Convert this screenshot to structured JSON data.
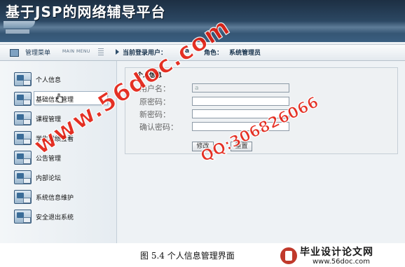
{
  "app": {
    "title": "基于JSP的网络辅导平台"
  },
  "topbar": {
    "menu_label": "管理菜单",
    "menu_label_en": "MAIN MENU",
    "user_label": "当前登录用户：",
    "user_value": "a",
    "role_label": "角色：",
    "role_value": "系统管理员"
  },
  "sidebar": {
    "items": [
      {
        "label": "个人信息",
        "icon": "user-info-icon"
      },
      {
        "label": "基础信息管理",
        "icon": "base-info-icon"
      },
      {
        "label": "课程管理",
        "icon": "course-icon"
      },
      {
        "label": "学生成绩查看",
        "icon": "grades-icon"
      },
      {
        "label": "公告管理",
        "icon": "notice-icon"
      },
      {
        "label": "内部论坛",
        "icon": "forum-icon"
      },
      {
        "label": "系统信息维护",
        "icon": "system-icon"
      },
      {
        "label": "安全退出系统",
        "icon": "logout-icon"
      }
    ]
  },
  "panel": {
    "title": "个人信息",
    "fields": {
      "username_label": "用户名：",
      "username_value": "a",
      "old_password_label": "原密码：",
      "new_password_label": "新密码：",
      "confirm_password_label": "确认密码："
    },
    "buttons": {
      "modify": "修改",
      "reset": "重置"
    }
  },
  "watermark": {
    "site": "www.56doc.com",
    "qq": "QQ:306826066"
  },
  "caption": "图 5.4 个人信息管理界面",
  "logo": {
    "text": "毕业设计论文网",
    "url": "www.56doc.com"
  },
  "colors": {
    "header": "#2d4a66",
    "watermark": "#e41c0e",
    "accent": "#3a6c98"
  }
}
